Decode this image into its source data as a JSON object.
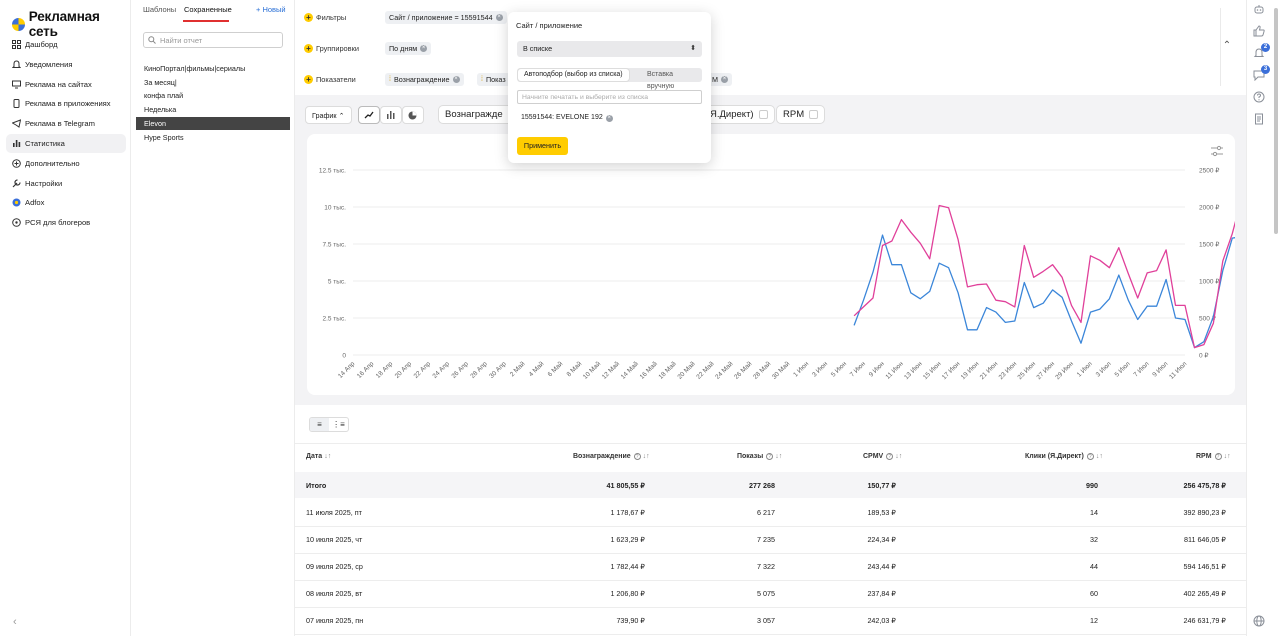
{
  "nav": {
    "logo": "Рекламная сеть",
    "items": [
      {
        "label": "Дашборд",
        "icon": "grid-icon"
      },
      {
        "label": "Уведомления",
        "icon": "bell-icon"
      },
      {
        "label": "Реклама на сайтах",
        "icon": "monitor-icon"
      },
      {
        "label": "Реклама в приложениях",
        "icon": "phone-icon"
      },
      {
        "label": "Реклама в Telegram",
        "icon": "telegram-icon"
      },
      {
        "label": "Статистика",
        "icon": "bar-chart-icon"
      },
      {
        "label": "Дополнительно",
        "icon": "plus-circle-icon"
      },
      {
        "label": "Настройки",
        "icon": "wrench-icon"
      },
      {
        "label": "Adfox",
        "icon": "adfox-icon"
      },
      {
        "label": "РСЯ для блогеров",
        "icon": "blogger-icon"
      }
    ],
    "active_index": 5
  },
  "reports": {
    "tabs": [
      "Шаблоны",
      "Сохраненные"
    ],
    "new_label": "+ Новый",
    "search_placeholder": "Найти отчет",
    "items": [
      "КиноПортал|фильмы|сериалы",
      "За месяц|",
      "конфа плай",
      "Неделька",
      "Elevon",
      "Hype Sports"
    ],
    "active_index": 4
  },
  "filters": {
    "filters_label": "Фильтры",
    "filter_chip": "Сайт / приложение = 15591544",
    "grouping_label": "Группировки",
    "grouping_chip": "По дням",
    "metrics_label": "Показатели",
    "metric_chip_1": "Вознаграждение",
    "metric_chip_2": "Показ",
    "metric_chip_3": "М"
  },
  "chart_toolbar": {
    "chart_button": "График",
    "metric_pills": [
      "Вознагражде",
      "Я.Директ)",
      "RPM"
    ]
  },
  "chart_data": {
    "type": "line",
    "x": [
      "14 Апр",
      "15 Апр",
      "16 Апр",
      "17 Апр",
      "18 Апр",
      "19 Апр",
      "20 Апр",
      "21 Апр",
      "22 Апр",
      "23 Апр",
      "24 Апр",
      "25 Апр",
      "26 Апр",
      "27 Апр",
      "28 Апр",
      "29 Апр",
      "30 Апр",
      "1 Май",
      "2 Май",
      "3 Май",
      "4 Май",
      "5 Май",
      "6 Май",
      "7 Май",
      "8 Май",
      "9 Май",
      "10 Май",
      "11 Май",
      "12 Май",
      "13 Май",
      "14 Май",
      "15 Май",
      "16 Май",
      "17 Май",
      "18 Май",
      "19 Май",
      "20 Май",
      "21 Май",
      "22 Май",
      "23 Май",
      "24 Май",
      "25 Май",
      "26 Май",
      "27 Май",
      "28 Май",
      "29 Май",
      "30 Май",
      "31 Май",
      "1 Июн",
      "2 Июн",
      "3 Июн",
      "4 Июн",
      "5 Июн",
      "6 Июн",
      "7 Июн",
      "8 Июн",
      "9 Июн",
      "10 Июн",
      "11 Июн",
      "12 Июн",
      "13 Июн",
      "14 Июн",
      "15 Июн",
      "16 Июн",
      "17 Июн",
      "18 Июн",
      "19 Июн",
      "20 Июн",
      "21 Июн",
      "22 Июн",
      "23 Июн",
      "24 Июн",
      "25 Июн",
      "26 Июн",
      "27 Июн",
      "28 Июн",
      "29 Июн",
      "30 Июн",
      "1 Июл",
      "2 Июл",
      "3 Июл",
      "4 Июл",
      "5 Июл",
      "6 Июл",
      "7 Июл",
      "8 Июл",
      "9 Июл",
      "10 Июл",
      "11 Июл"
    ],
    "x_tick_labels": [
      "14 Апр",
      "16 Апр",
      "18 Апр",
      "20 Апр",
      "22 Апр",
      "24 Апр",
      "26 Апр",
      "28 Апр",
      "30 Апр",
      "2 Май",
      "4 Май",
      "6 Май",
      "8 Май",
      "10 Май",
      "12 Май",
      "14 Май",
      "16 Май",
      "18 Май",
      "20 Май",
      "22 Май",
      "24 Май",
      "26 Май",
      "28 Май",
      "30 Май",
      "1 Июн",
      "3 Июн",
      "5 Июн",
      "7 Июн",
      "9 Июн",
      "11 Июн",
      "13 Июн",
      "15 Июн",
      "17 Июн",
      "19 Июн",
      "21 Июн",
      "23 Июн",
      "25 Июн",
      "27 Июн",
      "29 Июн",
      "1 Июл",
      "3 Июл",
      "5 Июл",
      "7 Июл",
      "9 Июл",
      "11 Июл"
    ],
    "y_left_ticks": [
      "0",
      "2.5 тыс.",
      "5 тыс.",
      "7.5 тыс.",
      "10 тыс.",
      "12.5 тыс."
    ],
    "y_right_ticks": [
      "0 ₽",
      "500 ₽",
      "1000 ₽",
      "1500 ₽",
      "2000 ₽",
      "2500 ₽"
    ],
    "ylim_left": [
      0,
      12500
    ],
    "ylim_right": [
      0,
      2500
    ],
    "series": [
      {
        "axis": "left",
        "color": "#3b86d9",
        "start_index": 53,
        "values": [
          2000,
          3700,
          5600,
          8100,
          6100,
          6100,
          4200,
          3800,
          4300,
          6200,
          5900,
          4200,
          1700,
          1700,
          3200,
          2900,
          2200,
          2300,
          4900,
          3200,
          3500,
          4400,
          3900,
          2300,
          800,
          2900,
          3100,
          3800,
          5400,
          3700,
          2400,
          3300,
          3300,
          5100,
          2500,
          2400,
          500,
          900,
          2600,
          5700,
          7900,
          8000,
          9900,
          7800,
          1800,
          3000,
          5500,
          9000,
          8100,
          6300
        ]
      },
      {
        "axis": "right",
        "color": "#e0409a",
        "start_index": 53,
        "values": [
          530,
          650,
          770,
          1480,
          1540,
          1830,
          1660,
          1510,
          1300,
          2020,
          1990,
          1560,
          920,
          950,
          960,
          740,
          720,
          650,
          1480,
          1050,
          1130,
          1220,
          1050,
          670,
          440,
          1340,
          1280,
          1180,
          1450,
          1100,
          770,
          1110,
          1140,
          1420,
          670,
          670,
          100,
          140,
          430,
          1270,
          1640,
          2120,
          1990,
          600,
          600,
          1090,
          1490,
          1480,
          1230,
          1150
        ]
      }
    ]
  },
  "table": {
    "headers": [
      "Дата",
      "Вознаграждение",
      "Показы",
      "CPMV",
      "Клики (Я.Директ)",
      "RPM"
    ],
    "total": [
      "Итого",
      "41 805,55 ₽",
      "277 268",
      "150,77 ₽",
      "990",
      "256 475,78 ₽"
    ],
    "rows": [
      [
        "11 июля 2025, пт",
        "1 178,67 ₽",
        "6 217",
        "189,53 ₽",
        "14",
        "392 890,23 ₽"
      ],
      [
        "10 июля 2025, чт",
        "1 623,29 ₽",
        "7 235",
        "224,34 ₽",
        "32",
        "811 646,05 ₽"
      ],
      [
        "09 июля 2025, ср",
        "1 782,44 ₽",
        "7 322",
        "243,44 ₽",
        "44",
        "594 146,51 ₽"
      ],
      [
        "08 июля 2025, вт",
        "1 206,80 ₽",
        "5 075",
        "237,84 ₽",
        "60",
        "402 265,49 ₽"
      ],
      [
        "07 июля 2025, пн",
        "739,90 ₽",
        "3 057",
        "242,03 ₽",
        "12",
        "246 631,79 ₽"
      ]
    ]
  },
  "popup": {
    "title": "Сайт / приложение",
    "select_value": "В списке",
    "tab_auto": "Автоподбор (выбор из списка)",
    "tab_manual": "Вставка вручную",
    "input_placeholder": "Начните печатать и выберите из списка",
    "selected_chip": "15591544: EVELONE 192",
    "apply_label": "Применить"
  },
  "rail": {
    "badges": [
      "2",
      "3"
    ]
  },
  "colors": {
    "accent": "#ffcc00",
    "blue_line": "#3b86d9",
    "pink_line": "#e0409a",
    "tab_underline": "#e03030"
  }
}
